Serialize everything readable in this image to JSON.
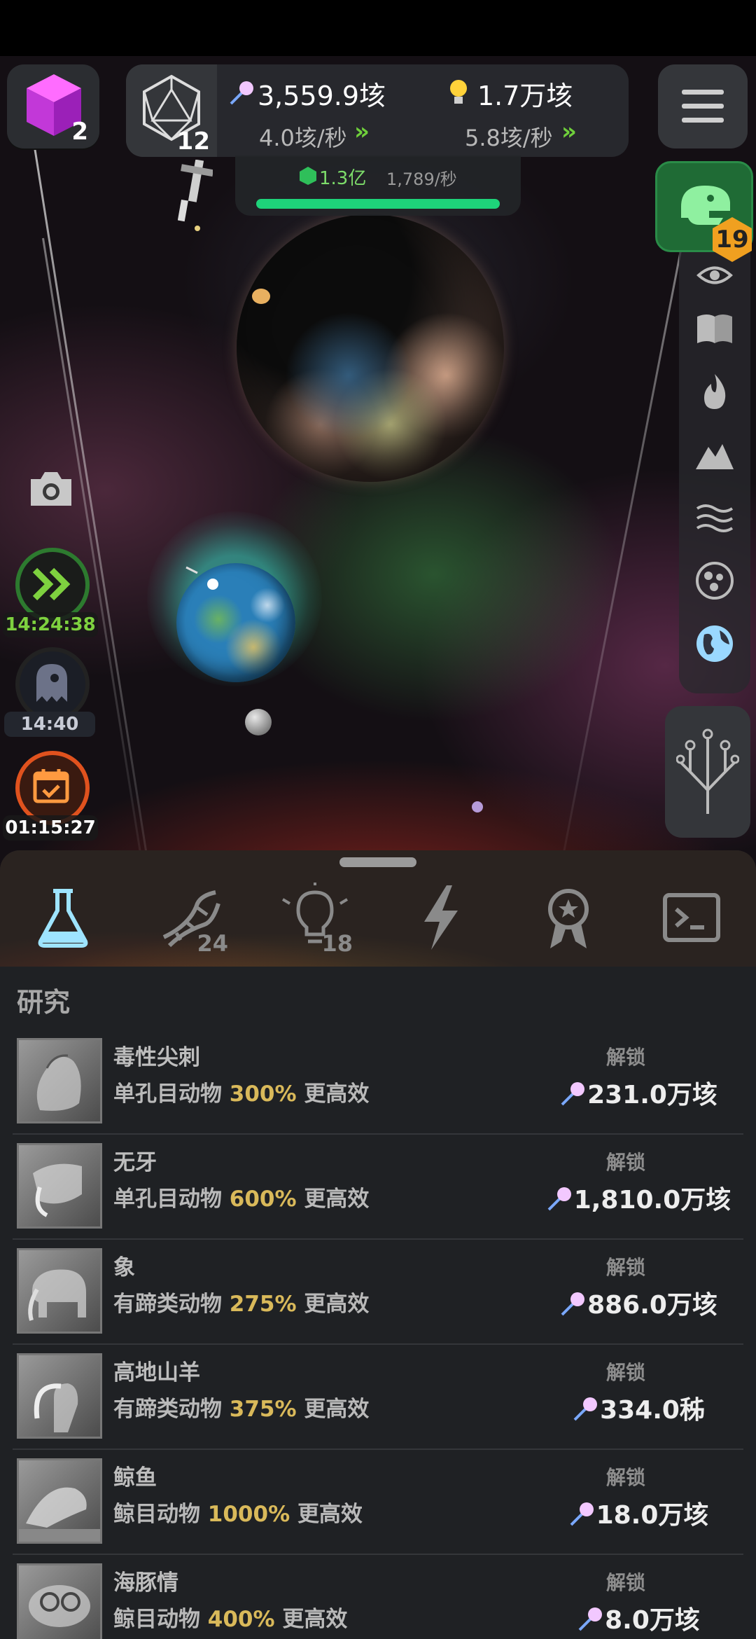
{
  "header": {
    "cube_count": "2",
    "d20_level": "12",
    "resource1": {
      "value": "3,559.9垓",
      "rate": "4.0垓/秒"
    },
    "resource2": {
      "value": "1.7万垓",
      "rate": "5.8垓/秒"
    },
    "gems": {
      "value": "1.3亿",
      "rate": "1,789/秒"
    },
    "gem_progress": 1.0,
    "dino_badge": "19"
  },
  "left_widgets": {
    "speed_timer": "14:24:38",
    "ghost_timer": "14:40",
    "calendar_timer": "01:15:27"
  },
  "tabs": [
    {
      "name": "research",
      "count": ""
    },
    {
      "name": "dna",
      "count": "24"
    },
    {
      "name": "ideas",
      "count": "18"
    },
    {
      "name": "power",
      "count": ""
    },
    {
      "name": "awards",
      "count": ""
    },
    {
      "name": "console",
      "count": ""
    }
  ],
  "section_title": "研究",
  "unlock_label": "解锁",
  "research": [
    {
      "name": "毒性尖刺",
      "group": "单孔目动物",
      "pct": "300%",
      "suffix": "更高效",
      "cost": "231.0万垓"
    },
    {
      "name": "无牙",
      "group": "单孔目动物",
      "pct": "600%",
      "suffix": "更高效",
      "cost": "1,810.0万垓"
    },
    {
      "name": "象",
      "group": "有蹄类动物",
      "pct": "275%",
      "suffix": "更高效",
      "cost": "886.0万垓"
    },
    {
      "name": "高地山羊",
      "group": "有蹄类动物",
      "pct": "375%",
      "suffix": "更高效",
      "cost": "334.0秭"
    },
    {
      "name": "鲸鱼",
      "group": "鲸目动物",
      "pct": "1000%",
      "suffix": "更高效",
      "cost": "18.0万垓"
    },
    {
      "name": "海豚情",
      "group": "鲸目动物",
      "pct": "400%",
      "suffix": "更高效",
      "cost": "8.0万垓"
    }
  ],
  "colors": {
    "accent_green": "#6fcf3b",
    "gem_bar": "#1ed37a",
    "pct_gold": "#d9b95a",
    "panel": "#1f2124"
  }
}
